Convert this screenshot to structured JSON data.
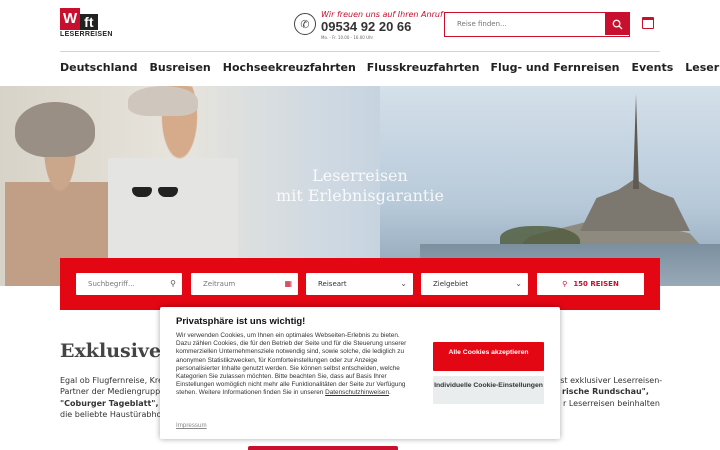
{
  "header": {
    "logo": {
      "mark": "W",
      "mark2": "ft",
      "text": "LESERREISEN"
    },
    "phone": {
      "tagline": "Wir freuen uns auf Ihren Anruf",
      "number": "09534 92 20 66",
      "hours": "Mo. - Fr. 10.00 - 16.00 Uhr"
    },
    "search": {
      "placeholder": "Reise finden..."
    },
    "icons": {
      "phone": "phone-icon",
      "search": "search-icon",
      "calendar": "calendar-icon"
    }
  },
  "nav": {
    "items": [
      "Deutschland",
      "Busreisen",
      "Hochseekreuzfahrten",
      "Flusskreuzfahrten",
      "Flug- und Fernreisen",
      "Events",
      "Leserreisen Vorteile"
    ]
  },
  "hero": {
    "title_line1": "Leserreisen",
    "title_line2": "mit Erlebnisgarantie"
  },
  "filters": {
    "keyword": "Suchbegriff...",
    "period": "Zeitraum",
    "travel_type": "Reiseart",
    "destination": "Zielgebiet",
    "results_button": "150 REISEN"
  },
  "content": {
    "title": "Exklusive L",
    "left_fragments": [
      "Egal ob Flugfernreise, Kreu",
      "Partner der Mediengruppe",
      "\"Coburger Tageblatt\", sow",
      "die beliebte Haustürabhol"
    ],
    "right_fragments": [
      "ist exklusiver Leserreisen-",
      "rische Rundschau\",",
      "r Leserreisen beinhalten"
    ]
  },
  "cookie": {
    "title": "Privatsphäre ist uns wichtig!",
    "text": "Wir verwenden Cookies, um Ihnen ein optimales Webseiten-Erlebnis zu bieten. Dazu zählen Cookies, die für den Betrieb der Seite und für die Steuerung unserer kommerziellen Unternehmensziele notwendig sind, sowie solche, die lediglich zu anonymen Statistikzwecken, für Komforteinstellungen oder zur Anzeige personalisierter Inhalte genutzt werden. Sie können selbst entscheiden, welche Kategorien Sie zulassen möchten. Bitte beachten Sie, dass auf Basis Ihrer Einstellungen womöglich nicht mehr alle Funktionalitäten der Seite zur Verfügung stehen. Weitere Informationen finden Sie in unseren ",
    "privacy_link": "Datenschutzhinweisen",
    "text_end": ".",
    "accept": "Alle Cookies akzeptieren",
    "custom": "Individuelle Cookie-Einstellungen",
    "impressum": "Impressum"
  },
  "colors": {
    "brand_red": "#e30613",
    "dark_red": "#c8102e"
  }
}
